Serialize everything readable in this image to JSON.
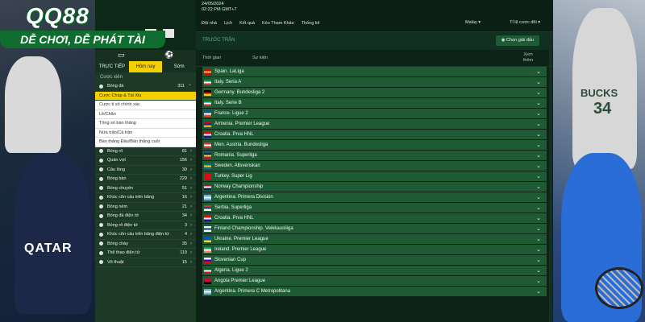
{
  "logo": {
    "brand": "QQ88",
    "slogan": "DỄ CHƠI, DỄ PHÁT TÀI"
  },
  "decor": {
    "left_jersey": "QATAR",
    "right_jersey": "BUCKS",
    "right_number": "34"
  },
  "topbar": {
    "date": "24/05/2024",
    "time": "02:22 PM GMT+7"
  },
  "nav": {
    "items": [
      "Đội nhà",
      "Lịch",
      "Kết quả",
      "Kèo Tham Khảo",
      "Thống kê"
    ],
    "language": "Malay",
    "odds_type": "Tỉ lệ cược đôi"
  },
  "section": {
    "label": "TRƯỚC TRẬN",
    "pick_button": "Chọn giải đấu"
  },
  "columns": {
    "time": "Thời gian",
    "event": "Sự kiện",
    "more": "Xem thêm"
  },
  "sidebar": {
    "tabs": [
      {
        "label": "TRỰC TIẾP",
        "active": false
      },
      {
        "label": "Hôm nay",
        "active": true
      },
      {
        "label": "Sớm",
        "active": false
      }
    ],
    "sub_label": "Cược xiên",
    "top_sport": {
      "label": "Bóng đá",
      "count": "311"
    },
    "bet_types": [
      "Cược Chấp & Tài Xỉu",
      "Cược tỉ số chính xác",
      "Lẻ/Chẵn",
      "Tổng số bàn thắng",
      "Nửa trận/Cả trận",
      "Bàn thắng Đầu/Bàn thắng cuối"
    ],
    "sports": [
      {
        "label": "Bóng rổ",
        "count": "81"
      },
      {
        "label": "Quần vợt",
        "count": "156"
      },
      {
        "label": "Cầu lông",
        "count": "30"
      },
      {
        "label": "Bóng bàn",
        "count": "229"
      },
      {
        "label": "Bóng chuyền",
        "count": "51"
      },
      {
        "label": "Khúc côn cầu trên băng",
        "count": "16"
      },
      {
        "label": "Bóng ném",
        "count": "21"
      },
      {
        "label": "Bóng đá điện tử",
        "count": "34"
      },
      {
        "label": "Bóng rổ điện tử",
        "count": "3"
      },
      {
        "label": "Khúc côn cầu trên băng điện tử",
        "count": "4"
      },
      {
        "label": "Bóng chày",
        "count": "35"
      },
      {
        "label": "Thể thao điện tử",
        "count": "119"
      },
      {
        "label": "Võ thuật",
        "count": "15"
      }
    ]
  },
  "leagues": [
    {
      "name": "Spain. LaLiga",
      "flag": [
        "#c60b1e",
        "#ffc400",
        "#c60b1e"
      ]
    },
    {
      "name": "Italy. Seria A",
      "flag": [
        "#009246",
        "#ffffff",
        "#ce2b37"
      ]
    },
    {
      "name": "Germany. Bundesliga 2",
      "flag": [
        "#000000",
        "#dd0000",
        "#ffce00"
      ]
    },
    {
      "name": "Italy. Serie B",
      "flag": [
        "#009246",
        "#ffffff",
        "#ce2b37"
      ]
    },
    {
      "name": "France. Ligue 2",
      "flag": [
        "#0055a4",
        "#ffffff",
        "#ef4135"
      ]
    },
    {
      "name": "Armenia. Premier League",
      "flag": [
        "#d90012",
        "#0033a0",
        "#f2a800"
      ]
    },
    {
      "name": "Croatia. Prva HNL",
      "flag": [
        "#ff0000",
        "#ffffff",
        "#171796"
      ]
    },
    {
      "name": "Men. Austria. Bundesliga",
      "flag": [
        "#ed2939",
        "#ffffff",
        "#ed2939"
      ]
    },
    {
      "name": "Romania. Superliga",
      "flag": [
        "#002b7f",
        "#fcd116",
        "#ce1126"
      ]
    },
    {
      "name": "Sweden. Allsvenskan",
      "flag": [
        "#006aa7",
        "#fecc00",
        "#006aa7"
      ]
    },
    {
      "name": "Turkey. Super Lig",
      "flag": [
        "#e30a17",
        "#e30a17",
        "#e30a17"
      ]
    },
    {
      "name": "Norway Championship",
      "flag": [
        "#ba0c2f",
        "#ffffff",
        "#00205b"
      ]
    },
    {
      "name": "Argentina. Primera Division",
      "flag": [
        "#74acdf",
        "#ffffff",
        "#74acdf"
      ]
    },
    {
      "name": "Serbia. Superliga",
      "flag": [
        "#c6363c",
        "#0c4076",
        "#ffffff"
      ]
    },
    {
      "name": "Croatia. Prva HNL",
      "flag": [
        "#ff0000",
        "#ffffff",
        "#171796"
      ]
    },
    {
      "name": "Finland Championship. Veikkausliiga",
      "flag": [
        "#ffffff",
        "#003580",
        "#ffffff"
      ]
    },
    {
      "name": "Ukraine. Premier League",
      "flag": [
        "#0057b7",
        "#0057b7",
        "#ffd700"
      ]
    },
    {
      "name": "Ireland. Premier League",
      "flag": [
        "#169b62",
        "#ffffff",
        "#ff883e"
      ]
    },
    {
      "name": "Slovenian Cup",
      "flag": [
        "#ffffff",
        "#0000ff",
        "#ff0000"
      ]
    },
    {
      "name": "Algeria. Ligue 2",
      "flag": [
        "#006233",
        "#ffffff",
        "#d21034"
      ]
    },
    {
      "name": "Angola Premier League",
      "flag": [
        "#cc092f",
        "#cc092f",
        "#000000"
      ]
    },
    {
      "name": "Argentina. Primera C Metropolitana",
      "flag": [
        "#74acdf",
        "#ffffff",
        "#74acdf"
      ]
    }
  ],
  "colors": {
    "accent": "#f5d000",
    "row": "#1e5a33",
    "panel": "#0d2317"
  }
}
